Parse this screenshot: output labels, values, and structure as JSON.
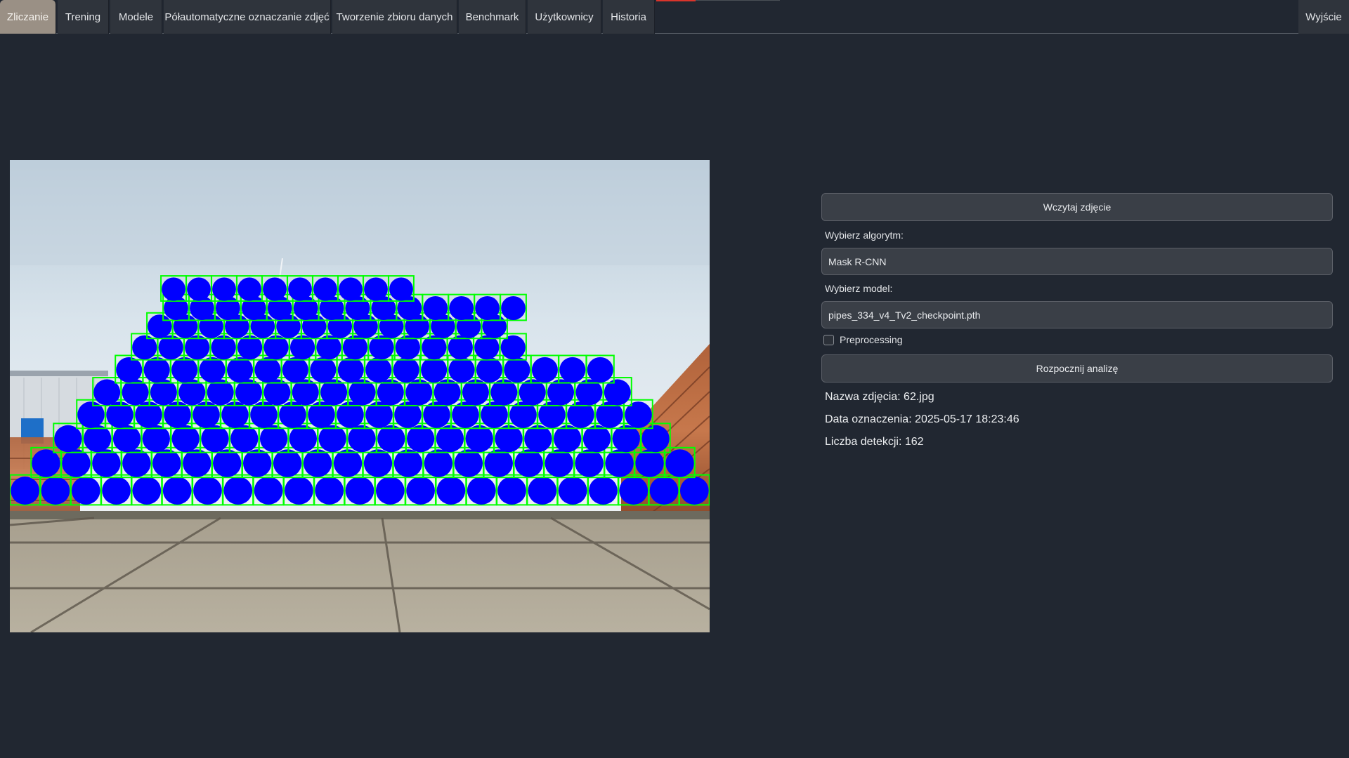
{
  "tabs": [
    {
      "label": "Zliczanie",
      "active": true
    },
    {
      "label": "Trening"
    },
    {
      "label": "Modele"
    },
    {
      "label": "Półautomatyczne oznaczanie zdjęć"
    },
    {
      "label": "Tworzenie zbioru danych"
    },
    {
      "label": "Benchmark"
    },
    {
      "label": "Użytkownicy"
    },
    {
      "label": "Historia"
    }
  ],
  "exit_label": "Wyjście",
  "panel": {
    "load_button": "Wczytaj zdjęcie",
    "algorithm_label": "Wybierz algorytm:",
    "algorithm_value": "Mask R-CNN",
    "model_label": "Wybierz model:",
    "model_value": "pipes_334_v4_Tv2_checkpoint.pth",
    "preprocessing_label": "Preprocessing",
    "preprocessing_checked": false,
    "analyze_button": "Rozpocznij analizę",
    "info": {
      "filename": "Nazwa zdjęcia: 62.jpg",
      "date": "Data oznaczenia: 2025-05-17 18:23:46",
      "count": "Liczba detekcji: 162"
    }
  },
  "colors": {
    "background": "#212731",
    "active_tab": "#9a9085",
    "detection_fill": "#0000ff",
    "detection_box": "#00ff00"
  }
}
